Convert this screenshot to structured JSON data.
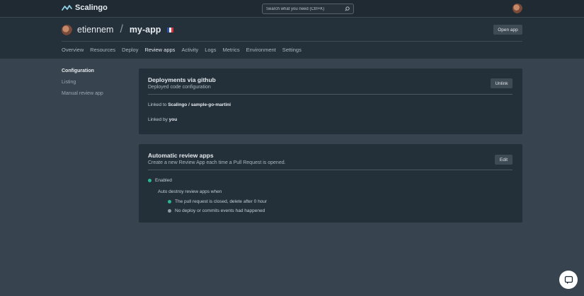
{
  "colors": {
    "enabled_dot": "#2ab78f",
    "disabled_dot": "#8f9aa3",
    "flag_blue": "#2b4ea8",
    "flag_white": "#f2f2f2",
    "flag_red": "#d8333c"
  },
  "topbar": {
    "brand": "Scalingo",
    "search_placeholder": "Search what you need (Ctrl+K)"
  },
  "header": {
    "owner": "etiennem",
    "separator": "/",
    "app_name": "my-app",
    "open_app_label": "Open app"
  },
  "nav": {
    "items": [
      "Overview",
      "Resources",
      "Deploy",
      "Review apps",
      "Activity",
      "Logs",
      "Metrics",
      "Environment",
      "Settings"
    ]
  },
  "sidebar": {
    "items": [
      "Configuration",
      "Listing",
      "Manual review app"
    ]
  },
  "github_card": {
    "title": "Deployments via github",
    "subtitle": "Deployed code configuration",
    "button": "Unlink",
    "linked_prefix": "Linked to ",
    "linked_repo": "Scalingo / sample-go-martini",
    "linked_by_prefix": "Linked by ",
    "linked_by": "you"
  },
  "review_card": {
    "title": "Automatic review apps",
    "subtitle": "Create a new Review App each time a Pull Request is opened.",
    "button": "Edit",
    "status": "Enabled",
    "auto_destroy": "Auto destroy review apps when",
    "rule_1": "The pull request is closed, delete after 0 hour",
    "rule_2": "No deploy or commits events had happened"
  }
}
